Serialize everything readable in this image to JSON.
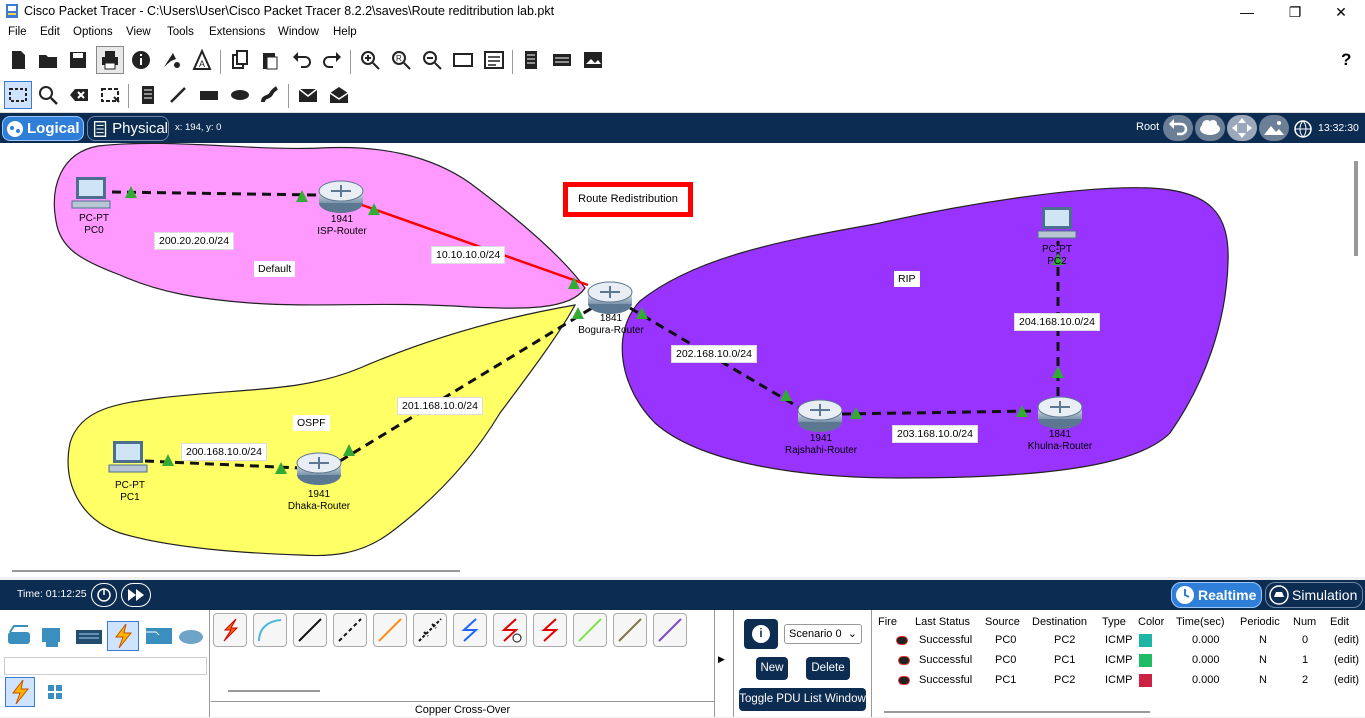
{
  "window": {
    "title": "Cisco Packet Tracer - C:\\Users\\User\\Cisco Packet Tracer 8.2.2\\saves\\Route reditribution lab.pkt",
    "minimize": "—",
    "maximize": "❐",
    "close": "✕"
  },
  "menu": [
    "File",
    "Edit",
    "Options",
    "View",
    "Tools",
    "Extensions",
    "Window",
    "Help"
  ],
  "help_icon": "?",
  "modebar": {
    "logical": "Logical",
    "physical": "Physical",
    "coords": "x: 194, y: 0",
    "root": "Root",
    "clock": "13:32:30"
  },
  "canvas": {
    "title_box": "Route Redistribution",
    "areas": {
      "default": "Default",
      "ospf": "OSPF",
      "rip": "RIP"
    },
    "networks": {
      "n1": "200.20.20.0/24",
      "n2": "10.10.10.0/24",
      "n3": "200.168.10.0/24",
      "n4": "201.168.10.0/24",
      "n5": "202.168.10.0/24",
      "n6": "203.168.10.0/24",
      "n7": "204.168.10.0/24"
    },
    "devices": {
      "pc0": {
        "model": "PC-PT",
        "name": "PC0"
      },
      "pc1": {
        "model": "PC-PT",
        "name": "PC1"
      },
      "pc2": {
        "model": "PC-PT",
        "name": "PC2"
      },
      "isp": {
        "model": "1941",
        "name": "ISP-Router"
      },
      "dhaka": {
        "model": "1941",
        "name": "Dhaka-Router"
      },
      "bogura": {
        "model": "1841",
        "name": "Bogura-Router"
      },
      "rajshahi": {
        "model": "1941",
        "name": "Rajshahi-Router"
      },
      "khulna": {
        "model": "1841",
        "name": "Khulna-Router"
      }
    },
    "colors": {
      "default_area": "#ff99ff",
      "ospf_area": "#ffff66",
      "rip_area": "#9933ff",
      "link_red": "#ff0000",
      "link_up": "#33aa33"
    }
  },
  "bottombar": {
    "time": "Time: 01:12:25",
    "realtime": "Realtime",
    "simulation": "Simulation"
  },
  "bottom": {
    "cable_label": "Copper Cross-Over",
    "scenario": "Scenario 0",
    "new": "New",
    "delete": "Delete",
    "toggle": "Toggle PDU List Window",
    "info_icon": "i",
    "pdu_headers": [
      "Fire",
      "Last Status",
      "Source",
      "Destination",
      "Type",
      "Color",
      "Time(sec)",
      "Periodic",
      "Num",
      "Edit"
    ],
    "pdu_rows": [
      {
        "status": "Successful",
        "source": "PC0",
        "dest": "PC2",
        "type": "ICMP",
        "color": "#1fb5a5",
        "time": "0.000",
        "periodic": "N",
        "num": "0",
        "edit": "(edit)"
      },
      {
        "status": "Successful",
        "source": "PC0",
        "dest": "PC1",
        "type": "ICMP",
        "color": "#1fbb66",
        "time": "0.000",
        "periodic": "N",
        "num": "1",
        "edit": "(edit)"
      },
      {
        "status": "Successful",
        "source": "PC1",
        "dest": "PC2",
        "type": "ICMP",
        "color": "#cc2244",
        "time": "0.000",
        "periodic": "N",
        "num": "2",
        "edit": "(edit)"
      }
    ]
  }
}
